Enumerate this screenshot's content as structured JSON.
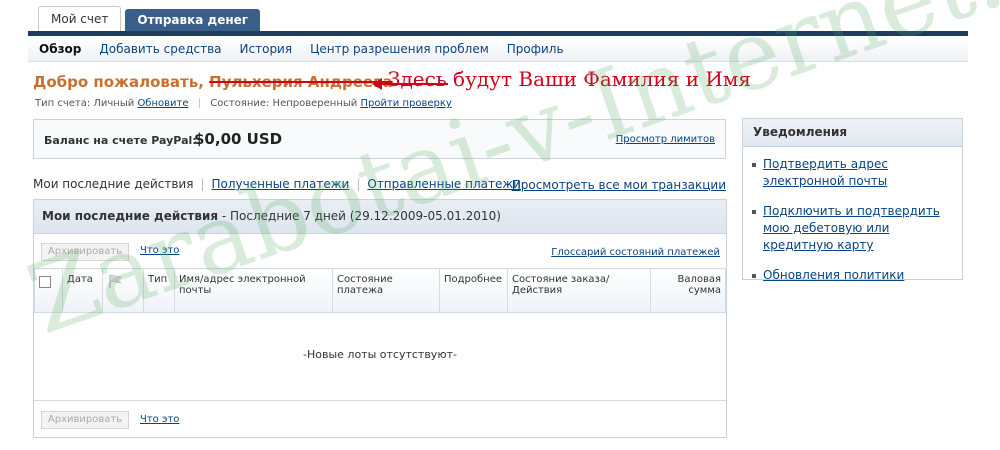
{
  "tabs": [
    {
      "label": "Мой счет",
      "active": true
    },
    {
      "label": "Отправка денег",
      "active": false
    }
  ],
  "subnav": [
    "Обзор",
    "Добавить средства",
    "История",
    "Центр разрешения проблем",
    "Профиль"
  ],
  "welcome": {
    "prefix": "Добро пожаловать,",
    "name": "Пульхерия Андреева"
  },
  "annotation": "Здесь будут Ваши Фамилия и Имя",
  "account": {
    "type_label": "Тип счета: Личный",
    "update_link": "Обновите",
    "status_label": "Состояние: Непроверенный",
    "verify_link": "Пройти проверку"
  },
  "balance": {
    "label": "Баланс на счете PayPal:",
    "amount": "$0,00 USD",
    "limits_link": "Просмотр лимитов"
  },
  "activity_links": {
    "current": "Мои последние действия",
    "received": "Полученные платежи",
    "sent": "Отправленные платежи",
    "all": "Просмотреть все мои транзакции"
  },
  "panel": {
    "title": "Мои последние действия",
    "range": " - Последние 7 дней (29.12.2009-05.01.2010)",
    "archive_button": "Архивировать",
    "what_is": "Что это",
    "glossary": "Глоссарий состояний платежей",
    "columns": [
      "",
      "Дата",
      "",
      "Тип",
      "Имя/адрес электронной почты",
      "Состояние платежа",
      "Подробнее",
      "Состояние заказа/Действия",
      "Валовая сумма"
    ],
    "empty": "-Новые лоты отсутствуют-"
  },
  "notifications": {
    "title": "Уведомления",
    "items": [
      "Подтвердить адрес электронной почты",
      "Подключить и подтвердить мою дебетовую или кредитную карту",
      "Обновления политики"
    ]
  },
  "watermark": "Zarabotai-v-Internet.ru",
  "colors": {
    "accent_orange": "#c8702f",
    "annotation_red": "#d0021b",
    "link_blue": "#084482",
    "tab_dark": "#1e3b60"
  }
}
